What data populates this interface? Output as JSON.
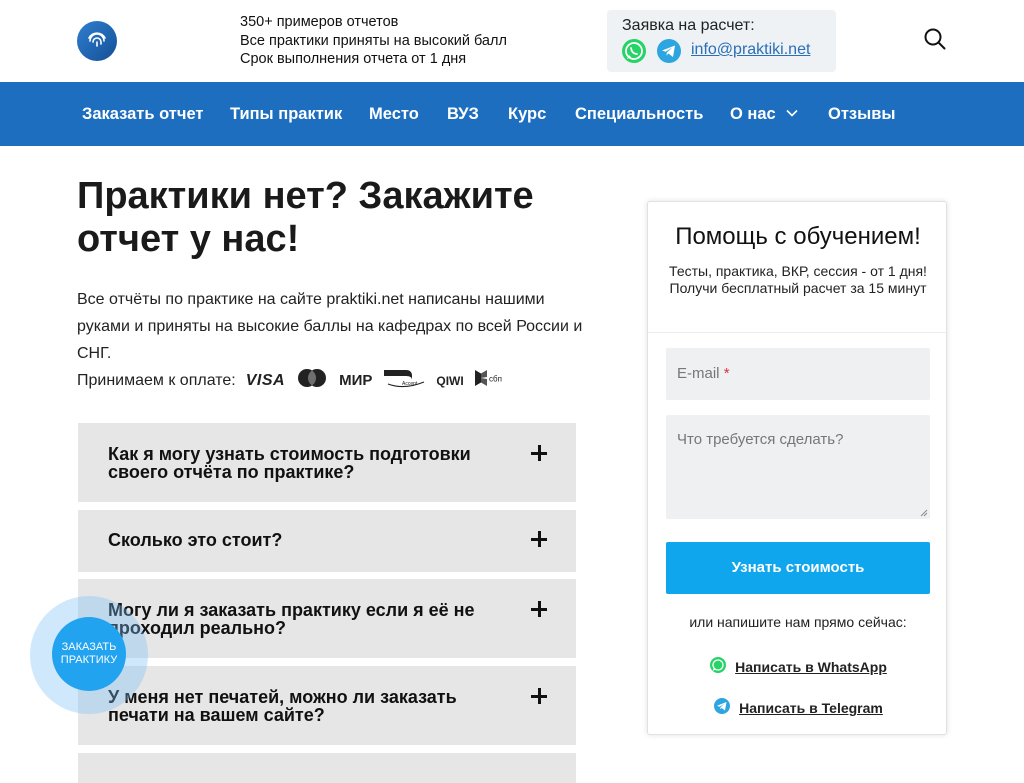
{
  "header": {
    "tagline": [
      "350+ примеров отчетов",
      "Все практики приняты на высокий балл",
      "Срок выполнения отчета от 1 дня"
    ],
    "contact_title": "Заявка на расчет:",
    "email": "info@praktiki.net"
  },
  "nav": {
    "items": [
      "Заказать отчет",
      "Типы практик",
      "Место",
      "ВУЗ",
      "Курс",
      "Специальность",
      "О нас",
      "Отзывы"
    ]
  },
  "main": {
    "title": "Практики нет? Закажите отчет у нас!",
    "intro": "Все отчёты по практике на сайте praktiki.net написаны нашими руками и приняты на высокие баллы на кафедрах по всей России и СНГ.",
    "payment_label": "Принимаем к оплате:",
    "payment_methods": [
      "VISA",
      "Mastercard",
      "МИР",
      "МИР Accept",
      "QIWI",
      "СБП"
    ],
    "faq": [
      "Как я могу узнать стоимость подготовки своего отчёта по практике?",
      "Сколько это стоит?",
      "Могу ли я заказать практику если я её не проходил реально?",
      "У меня нет печатей, можно ли заказать печати на вашем сайте?"
    ]
  },
  "floating_cta": {
    "line1": "ЗАКАЗАТЬ",
    "line2": "ПРАКТИКУ"
  },
  "sidebar": {
    "title": "Помощь с обучением!",
    "subtitle": "Тесты, практика, ВКР, сессия - от 1 дня! Получи бесплатный расчет за 15 минут",
    "email_placeholder": "E-mail",
    "email_required": "*",
    "task_placeholder": "Что требуется сделать?",
    "submit_label": "Узнать стоимость",
    "or_text": "или напишите нам прямо сейчас:",
    "whatsapp_label": "Написать в WhatsApp",
    "telegram_label": "Написать в Telegram"
  },
  "colors": {
    "nav_bg": "#1e6ec0",
    "button_bg": "#10a6ee",
    "faq_bg": "#e6e6e6",
    "whatsapp": "#25d366",
    "telegram": "#2ca5e0"
  }
}
